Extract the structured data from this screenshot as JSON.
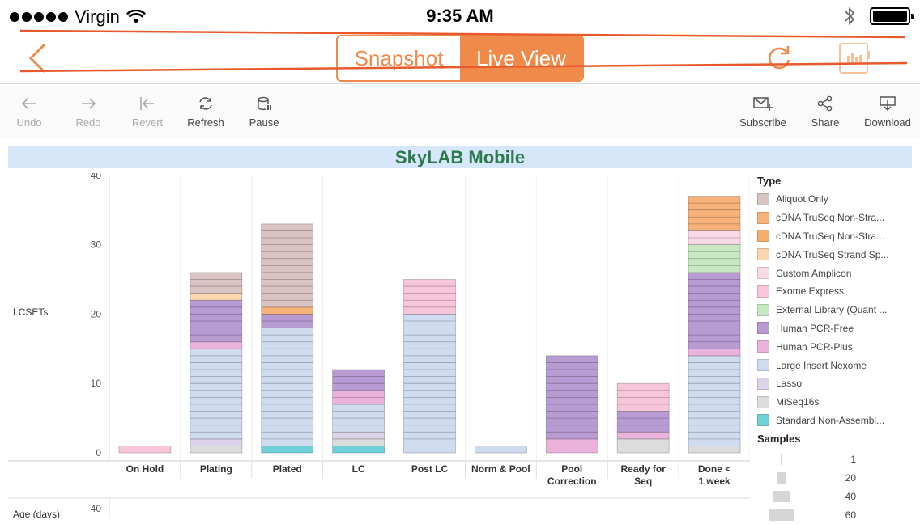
{
  "status": {
    "carrier": "Virgin",
    "time": "9:35 AM"
  },
  "nav": {
    "segment_snapshot": "Snapshot",
    "segment_live": "Live View",
    "accent": "#ef8a4a"
  },
  "toolbar": {
    "undo": "Undo",
    "redo": "Redo",
    "revert": "Revert",
    "refresh": "Refresh",
    "pause": "Pause",
    "subscribe": "Subscribe",
    "share": "Share",
    "download": "Download"
  },
  "banner": {
    "title": "SkyLAB Mobile"
  },
  "legend": {
    "type_title": "Type",
    "types": [
      {
        "label": "Aliquot Only",
        "color": "#d9c3c3"
      },
      {
        "label": "cDNA TruSeq Non-Stra...",
        "color": "#f7b27a"
      },
      {
        "label": "cDNA TruSeq Non-Stra...",
        "color": "#f5ad6e"
      },
      {
        "label": "cDNA TruSeq Strand Sp...",
        "color": "#fbd5ad"
      },
      {
        "label": "Custom Amplicon",
        "color": "#f9d9e6"
      },
      {
        "label": "Exome Express",
        "color": "#f7c6da"
      },
      {
        "label": "External Library (Quant ...",
        "color": "#c7e8c0"
      },
      {
        "label": "Human PCR-Free",
        "color": "#b79bd2"
      },
      {
        "label": "Human PCR-Plus",
        "color": "#eab2dc"
      },
      {
        "label": "Large Insert Nexome",
        "color": "#cfdcef"
      },
      {
        "label": "Lasso",
        "color": "#dcd3e8"
      },
      {
        "label": "MiSeq16s",
        "color": "#dcdcdc"
      },
      {
        "label": "Standard Non-Assembl...",
        "color": "#6fd0d8"
      }
    ],
    "samples_title": "Samples",
    "samples": [
      "1",
      "20",
      "40",
      "60"
    ]
  },
  "chart_data": [
    {
      "type": "bar",
      "ylabel": "LCSETs",
      "ylim": [
        0,
        40
      ],
      "yticks": [
        0,
        10,
        20,
        30,
        40
      ],
      "categories": [
        "On Hold",
        "Plating",
        "Plated",
        "LC",
        "Post LC",
        "Norm & Pool",
        "Pool Correction",
        "Ready for Seq",
        "Done < 1 week"
      ],
      "stacks": [
        [
          {
            "type": "Exome Express",
            "value": 1
          }
        ],
        [
          {
            "type": "MiSeq16s",
            "value": 1
          },
          {
            "type": "Lasso",
            "value": 1
          },
          {
            "type": "Large Insert Nexome",
            "value": 13
          },
          {
            "type": "Human PCR-Plus",
            "value": 1
          },
          {
            "type": "Human PCR-Free",
            "value": 6
          },
          {
            "type": "cDNA TruSeq Strand Sp...",
            "value": 1
          },
          {
            "type": "Aliquot Only",
            "value": 3
          }
        ],
        [
          {
            "type": "Standard Non-Assembl...",
            "value": 1
          },
          {
            "type": "Large Insert Nexome",
            "value": 17
          },
          {
            "type": "Human PCR-Free",
            "value": 2
          },
          {
            "type": "cDNA TruSeq Non-Stra...",
            "value": 1
          },
          {
            "type": "Aliquot Only",
            "value": 12
          }
        ],
        [
          {
            "type": "Standard Non-Assembl...",
            "value": 1
          },
          {
            "type": "MiSeq16s",
            "value": 1
          },
          {
            "type": "Lasso",
            "value": 1
          },
          {
            "type": "Large Insert Nexome",
            "value": 4
          },
          {
            "type": "Human PCR-Plus",
            "value": 2
          },
          {
            "type": "Human PCR-Free",
            "value": 3
          }
        ],
        [
          {
            "type": "Large Insert Nexome",
            "value": 20
          },
          {
            "type": "Exome Express",
            "value": 5
          }
        ],
        [
          {
            "type": "Large Insert Nexome",
            "value": 1
          }
        ],
        [
          {
            "type": "Human PCR-Plus",
            "value": 2
          },
          {
            "type": "Human PCR-Free",
            "value": 12
          }
        ],
        [
          {
            "type": "MiSeq16s",
            "value": 2
          },
          {
            "type": "Human PCR-Plus",
            "value": 1
          },
          {
            "type": "Human PCR-Free",
            "value": 3
          },
          {
            "type": "Exome Express",
            "value": 4
          }
        ],
        [
          {
            "type": "MiSeq16s",
            "value": 1
          },
          {
            "type": "Large Insert Nexome",
            "value": 13
          },
          {
            "type": "Human PCR-Plus",
            "value": 1
          },
          {
            "type": "Human PCR-Free",
            "value": 11
          },
          {
            "type": "External Library (Quant ...",
            "value": 4
          },
          {
            "type": "Custom Amplicon",
            "value": 2
          },
          {
            "type": "cDNA TruSeq Non-Stra...",
            "value": 5
          }
        ]
      ]
    },
    {
      "type": "bar",
      "ylabel": "Age (days)",
      "ytick_top": "40"
    }
  ]
}
